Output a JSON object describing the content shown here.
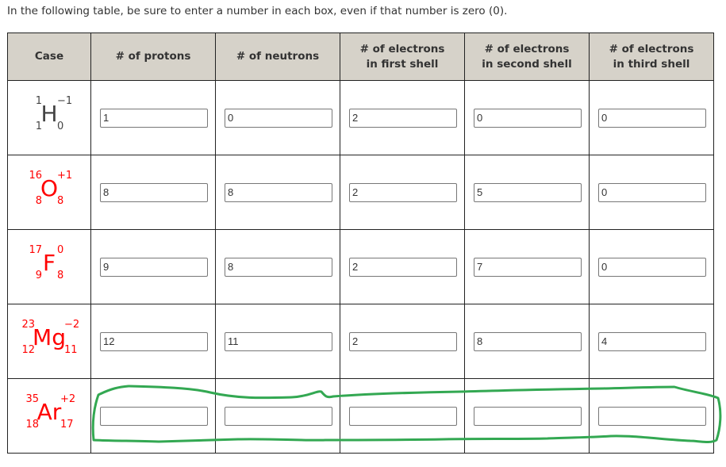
{
  "instruction": "In the following table, be sure to enter a number in each box, even if that number is zero (0).",
  "headers": [
    [
      "Case"
    ],
    [
      "# of protons"
    ],
    [
      "# of neutrons"
    ],
    [
      "# of electrons",
      "in first shell"
    ],
    [
      "# of electrons",
      "in second shell"
    ],
    [
      "# of electrons",
      "in third shell"
    ]
  ],
  "rows": [
    {
      "case": {
        "symbol": "H",
        "mass": "1",
        "atomic": "1",
        "charge": "−1",
        "neutron_sub": "0",
        "color": "#444444"
      },
      "values": [
        "1",
        "0",
        "2",
        "0",
        "0"
      ]
    },
    {
      "case": {
        "symbol": "O",
        "mass": "16",
        "atomic": "8",
        "charge": "+1",
        "neutron_sub": "8",
        "color": "#ff0000"
      },
      "values": [
        "8",
        "8",
        "2",
        "5",
        "0"
      ]
    },
    {
      "case": {
        "symbol": "F",
        "mass": "17",
        "atomic": "9",
        "charge": "0",
        "neutron_sub": "8",
        "color": "#ff0000"
      },
      "values": [
        "9",
        "8",
        "2",
        "7",
        "0"
      ]
    },
    {
      "case": {
        "symbol": "Mg",
        "mass": "23",
        "atomic": "12",
        "charge": "−2",
        "neutron_sub": "11",
        "color": "#ff0000"
      },
      "values": [
        "12",
        "11",
        "2",
        "8",
        "4"
      ]
    },
    {
      "case": {
        "symbol": "Ar",
        "mass": "35",
        "atomic": "18",
        "charge": "+2",
        "neutron_sub": "17",
        "color": "#ff0000"
      },
      "values": [
        "",
        "",
        "",
        "",
        ""
      ]
    }
  ],
  "annotation": {
    "type": "freehand-outline",
    "target": "last-row-inputs",
    "color": "#33a852"
  },
  "colors": {
    "header_bg": "#d6d2c9",
    "border": "#222222",
    "text": "#333333",
    "highlight": "#33a852"
  }
}
